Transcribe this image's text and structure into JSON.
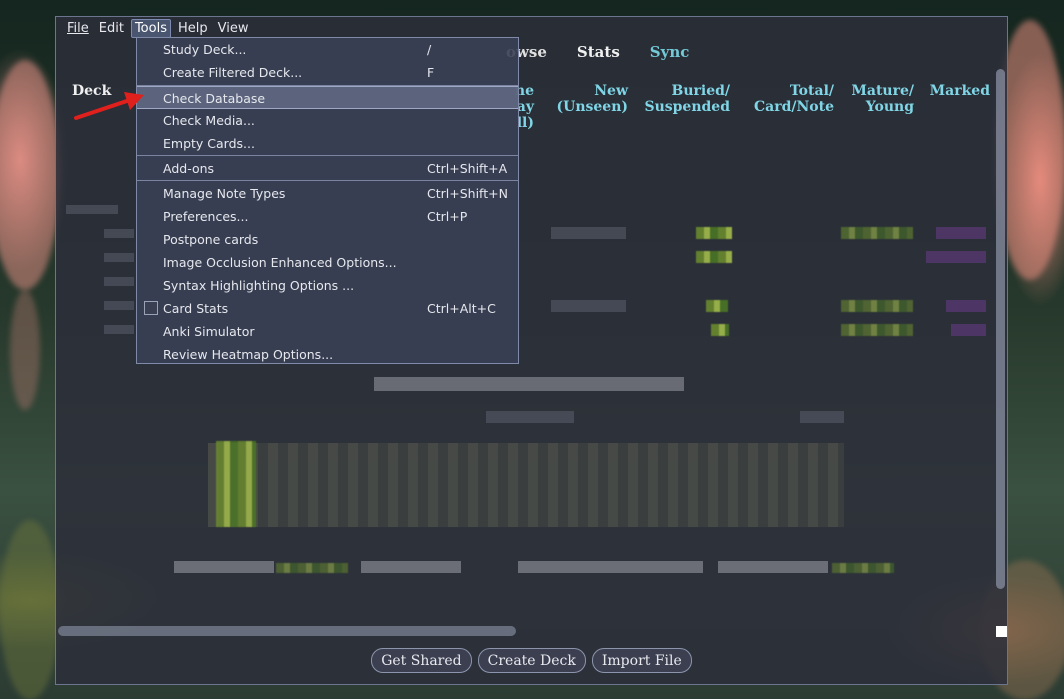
{
  "menubar": {
    "items": [
      "File",
      "Edit",
      "Tools",
      "Help",
      "View"
    ],
    "active": "Tools"
  },
  "toplinks": {
    "browse": "owse",
    "stats": "Stats",
    "sync": "Sync"
  },
  "deck_table": {
    "headers": {
      "deck": "Deck",
      "due_partial_1": "ne",
      "due_partial_2": "ay",
      "due_partial_3": "ll)",
      "new_1": "New",
      "new_2": "(Unseen)",
      "buried_1": "Buried/",
      "buried_2": "Suspended",
      "total_1": "Total/",
      "total_2": "Card/Note",
      "mature_1": "Mature/",
      "mature_2": "Young",
      "marked": "Marked"
    }
  },
  "tools_menu": {
    "items": [
      {
        "label": "Study Deck...",
        "shortcut": "/"
      },
      {
        "label": "Create Filtered Deck...",
        "shortcut": "F"
      },
      {
        "label": "Check Database",
        "shortcut": ""
      },
      {
        "label": "Check Media...",
        "shortcut": ""
      },
      {
        "label": "Empty Cards...",
        "shortcut": ""
      },
      {
        "label": "Add-ons",
        "shortcut": "Ctrl+Shift+A"
      },
      {
        "label": "Manage Note Types",
        "shortcut": "Ctrl+Shift+N"
      },
      {
        "label": "Preferences...",
        "shortcut": "Ctrl+P"
      },
      {
        "label": "Postpone cards",
        "shortcut": ""
      },
      {
        "label": "Image Occlusion Enhanced Options...",
        "shortcut": ""
      },
      {
        "label": "Syntax Highlighting Options ...",
        "shortcut": ""
      },
      {
        "label": "Card Stats",
        "shortcut": "Ctrl+Alt+C"
      },
      {
        "label": "Anki Simulator",
        "shortcut": ""
      },
      {
        "label": "Review Heatmap Options...",
        "shortcut": ""
      }
    ],
    "highlighted": "Check Database"
  },
  "bottom_buttons": {
    "get_shared": "Get Shared",
    "create_deck": "Create Deck",
    "import_file": "Import File"
  },
  "colors": {
    "link_accent": "#73c9d6",
    "arrow": "#e0201c"
  }
}
